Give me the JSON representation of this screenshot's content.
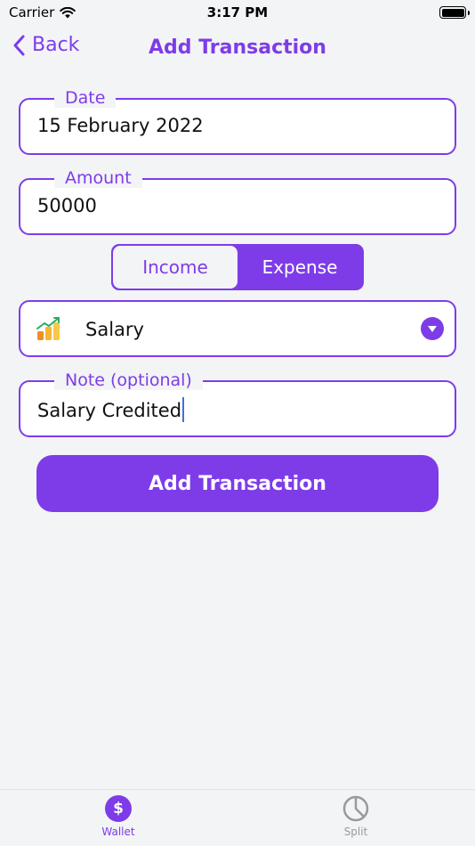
{
  "status_bar": {
    "carrier": "Carrier",
    "time": "3:17 PM"
  },
  "nav": {
    "back_label": "Back",
    "title": "Add Transaction"
  },
  "form": {
    "date": {
      "label": "Date",
      "value": "15 February 2022"
    },
    "amount": {
      "label": "Amount",
      "value": "50000"
    },
    "type_toggle": {
      "options": [
        "Income",
        "Expense"
      ],
      "selected": "Expense"
    },
    "category": {
      "value": "Salary",
      "icon": "growth-chart-icon"
    },
    "note": {
      "label": "Note (optional)",
      "value": "Salary Credited"
    },
    "submit_label": "Add Transaction"
  },
  "tab_bar": {
    "items": [
      {
        "label": "Wallet",
        "icon": "dollar-icon",
        "active": true,
        "glyph": "$"
      },
      {
        "label": "Split",
        "icon": "pie-chart-icon",
        "active": false
      }
    ]
  },
  "colors": {
    "accent": "#7e3ce8",
    "background": "#f2f4f6",
    "inactive_tab": "#9a9a9a"
  }
}
